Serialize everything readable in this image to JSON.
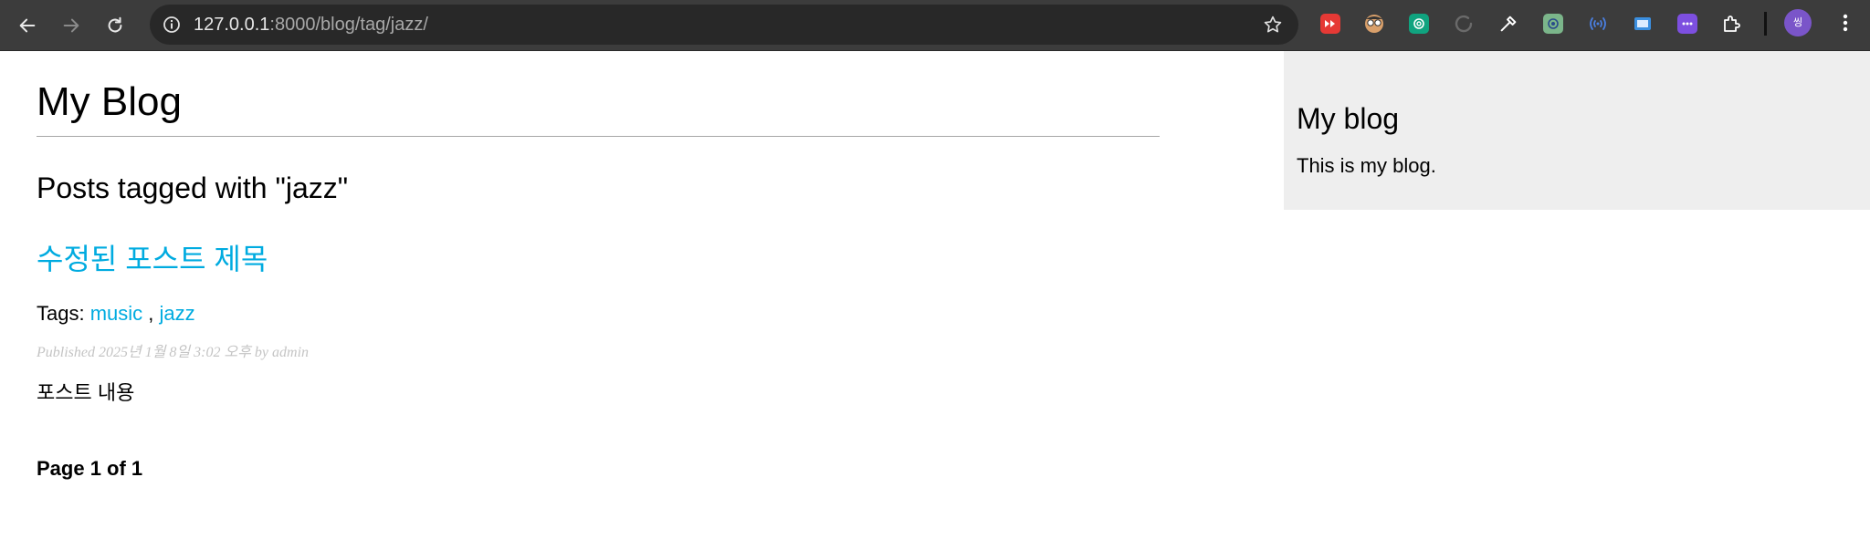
{
  "browser": {
    "url_host": "127.0.0.1",
    "url_rest": ":8000/blog/tag/jazz/",
    "extensions": [
      {
        "name": "youtube-extension-icon",
        "color": "#e53935"
      },
      {
        "name": "face-extension-icon",
        "color": "#d9a06b"
      },
      {
        "name": "chatgpt-extension-icon",
        "color": "#10a37f"
      },
      {
        "name": "reload-extension-icon",
        "color": "#666666"
      },
      {
        "name": "eyedropper-extension-icon",
        "color": "#ffffff"
      },
      {
        "name": "translate-extension-icon",
        "color": "#7bb58a"
      },
      {
        "name": "broadcast-extension-icon",
        "color": "#4a7fe0"
      },
      {
        "name": "screenshot-extension-icon",
        "color": "#3b8fe0"
      },
      {
        "name": "chat-extension-icon",
        "color": "#7d4fe0"
      },
      {
        "name": "puzzle-extensions-icon",
        "color": "#ffffff"
      }
    ],
    "avatar_text": "씽"
  },
  "page": {
    "site_title": "My Blog",
    "tag_heading": "Posts tagged with \"jazz\"",
    "post": {
      "title": "수정된 포스트 제목",
      "tags_label": "Tags:",
      "tags": [
        "music",
        "jazz"
      ],
      "tag_separator": " , ",
      "published": "Published 2025년 1월 8일 3:02 오후 by admin",
      "body": "포스트 내용"
    },
    "pagination": "Page 1 of 1"
  },
  "sidebar": {
    "title": "My blog",
    "text": "This is my blog."
  },
  "colors": {
    "link": "#00abe0",
    "sidebar_bg": "#eeeeee",
    "toolbar_bg": "#3c3c3c"
  }
}
